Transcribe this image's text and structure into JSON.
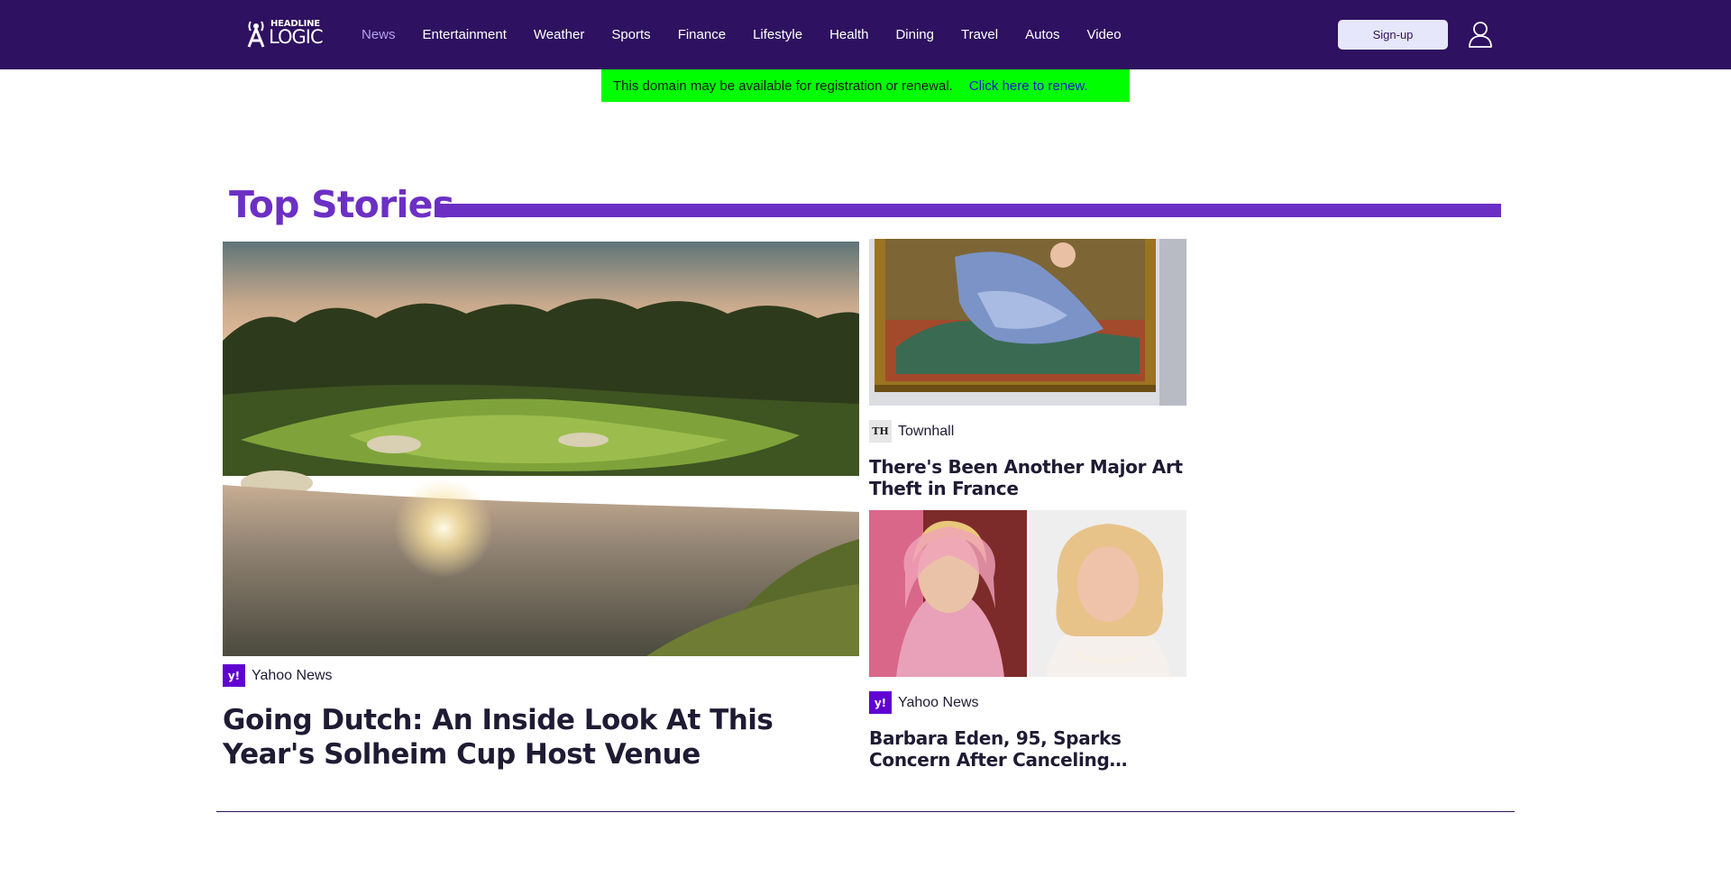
{
  "brand": {
    "logo_top": "HEADLINE",
    "logo_bottom": "LOGIC",
    "colors": {
      "header_bg": "#2e1160",
      "accent": "#6c2fc4",
      "active_nav": "#b4a1ef",
      "banner_bg": "#00ff00"
    }
  },
  "nav": {
    "items": [
      {
        "label": "News",
        "active": true
      },
      {
        "label": "Entertainment"
      },
      {
        "label": "Weather"
      },
      {
        "label": "Sports"
      },
      {
        "label": "Finance"
      },
      {
        "label": "Lifestyle"
      },
      {
        "label": "Health"
      },
      {
        "label": "Dining"
      },
      {
        "label": "Travel"
      },
      {
        "label": "Autos"
      },
      {
        "label": "Video"
      }
    ],
    "signup_label": "Sign-up",
    "user_icon": "user-icon"
  },
  "banner": {
    "text": "This domain may be available for registration or renewal.",
    "link": "Click here to renew."
  },
  "top_stories": {
    "title": "Top Stories",
    "main": {
      "source": "Yahoo News",
      "source_icon": "yahoo-icon",
      "headline": "Going Dutch: An Inside Look At This Year's Solheim Cup Host Venue",
      "image": "golf-course-sunset-image"
    },
    "side": [
      {
        "source": "Townhall",
        "source_icon": "townhall-icon",
        "source_icon_text": "TH",
        "headline": "There's Been Another Major Art Theft in France",
        "image": "framed-painting-image"
      },
      {
        "source": "Yahoo News",
        "source_icon": "yahoo-icon",
        "headline": "Barbara Eden, 95, Sparks Concern After Canceling…",
        "image": "actress-portraits-image"
      }
    ]
  }
}
